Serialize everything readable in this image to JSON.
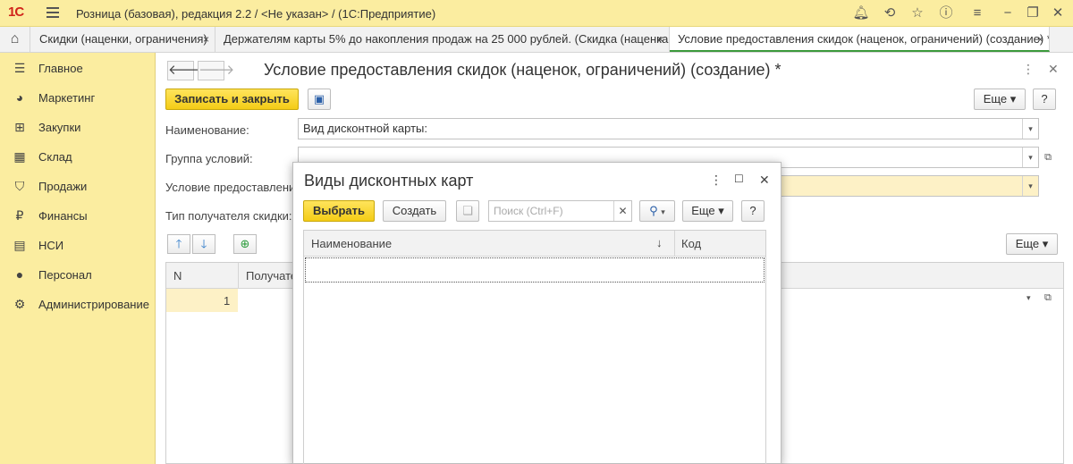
{
  "app": {
    "logo": "1С",
    "title": "Розница (базовая), редакция 2.2 / <Не указан> / (1С:Предприятие)"
  },
  "tabs": [
    {
      "label": "Скидки (наценки, ограничения)",
      "close": "×"
    },
    {
      "label": "Держателям карты 5% до накопления продаж на 25 000 рублей. (Скидка (наценка...",
      "close": "×"
    },
    {
      "label": "Условие предоставления скидок (наценок, ограничений) (создание) *",
      "close": "×"
    }
  ],
  "sidebar": {
    "items": [
      {
        "label": "Главное",
        "icon": "list-icon"
      },
      {
        "label": "Маркетинг",
        "icon": "pie-chart-icon"
      },
      {
        "label": "Закупки",
        "icon": "cart-icon"
      },
      {
        "label": "Склад",
        "icon": "warehouse-icon"
      },
      {
        "label": "Продажи",
        "icon": "shopping-bag-icon"
      },
      {
        "label": "Финансы",
        "icon": "ruble-coin-icon"
      },
      {
        "label": "НСИ",
        "icon": "database-icon"
      },
      {
        "label": "Персонал",
        "icon": "person-icon"
      },
      {
        "label": "Администрирование",
        "icon": "gear-icon"
      }
    ]
  },
  "form": {
    "title": "Условие предоставления скидок (наценок, ограничений) (создание) *",
    "save_close": "Записать и закрыть",
    "more": "Еще",
    "help": "?",
    "fields": {
      "name_label": "Наименование:",
      "name_value": "Вид дисконтной карты:",
      "group_label": "Группа условий:",
      "condition_label": "Условие предоставления",
      "recipient_label": "Тип получателя скидки:"
    },
    "table": {
      "col_n": "N",
      "col_recipient": "Получате",
      "rows": [
        {
          "n": "1"
        }
      ]
    },
    "table_more": "Еще"
  },
  "modal": {
    "title": "Виды дисконтных карт",
    "select": "Выбрать",
    "create": "Создать",
    "search_placeholder": "Поиск (Ctrl+F)",
    "more": "Еще",
    "help": "?",
    "col_name": "Наименование",
    "sort_indicator": "↓",
    "col_code": "Код"
  }
}
